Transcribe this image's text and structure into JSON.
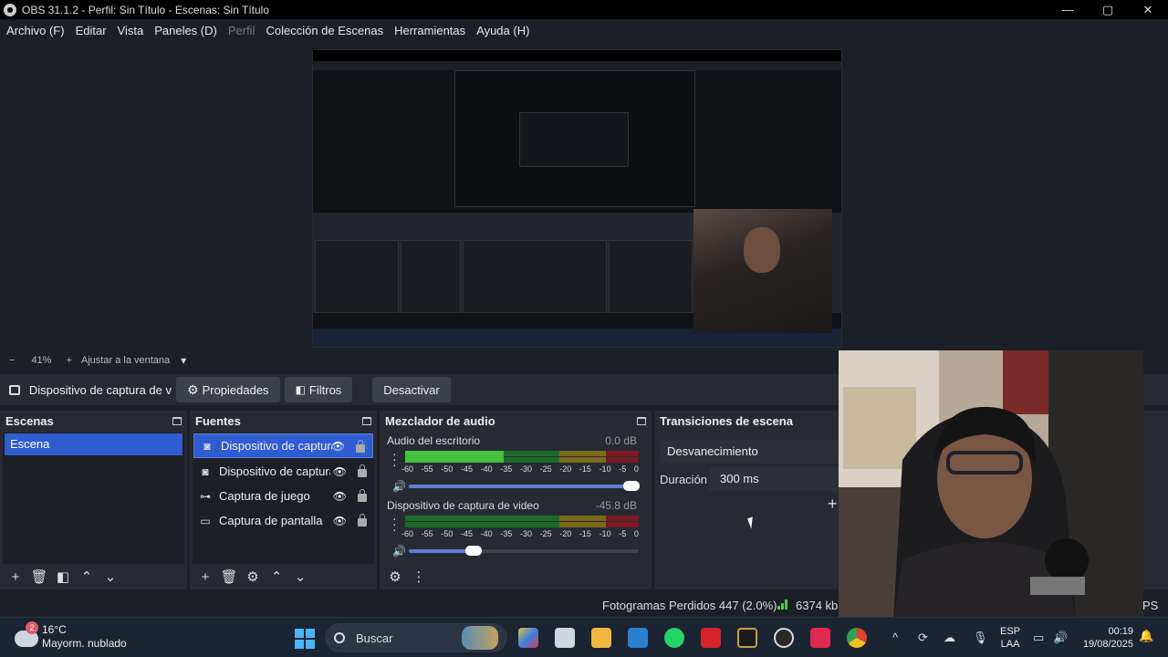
{
  "window": {
    "title": "OBS 31.1.2 - Perfil: Sin Título - Escenas: Sin Título",
    "minimize": "—",
    "maximize": "▢",
    "close": "✕"
  },
  "menu": [
    {
      "label": "Archivo (F)",
      "disabled": false
    },
    {
      "label": "Editar",
      "disabled": false
    },
    {
      "label": "Vista",
      "disabled": false
    },
    {
      "label": "Paneles (D)",
      "disabled": false
    },
    {
      "label": "Perfil",
      "disabled": true
    },
    {
      "label": "Colección de Escenas",
      "disabled": false
    },
    {
      "label": "Herramientas",
      "disabled": false
    },
    {
      "label": "Ayuda (H)",
      "disabled": false
    }
  ],
  "zoom": {
    "minus": "−",
    "value": "41%",
    "plus": "+",
    "fit": "Ajustar a la ventana",
    "caret": "▾"
  },
  "source_toolbar": {
    "source_name": "Dispositivo de captura de v",
    "properties": "Propiedades",
    "filters": "Filtros",
    "deactivate": "Desactivar"
  },
  "scenes": {
    "title": "Escenas",
    "items": [
      "Escena"
    ]
  },
  "sources": {
    "title": "Fuentes",
    "items": [
      {
        "label": "Dispositivo de captura",
        "icon": "camera-icon",
        "glyph": "◙",
        "selected": true
      },
      {
        "label": "Dispositivo de captura",
        "icon": "camera-icon",
        "glyph": "◙",
        "selected": false
      },
      {
        "label": "Captura de juego",
        "icon": "gamepad-icon",
        "glyph": "⊶",
        "selected": false
      },
      {
        "label": "Captura de pantalla",
        "icon": "monitor-icon",
        "glyph": "▭",
        "selected": false
      }
    ]
  },
  "mixer": {
    "title": "Mezclador de audio",
    "ticks": [
      "-60",
      "-55",
      "-50",
      "-45",
      "-40",
      "-35",
      "-30",
      "-25",
      "-20",
      "-15",
      "-10",
      "-5",
      "0"
    ],
    "channels": [
      {
        "name": "Audio del escritorio",
        "db": "0.0 dB",
        "level": 0.42,
        "volume": 0.97
      },
      {
        "name": "Dispositivo de captura de video",
        "db": "-45.8 dB",
        "level": 0.0,
        "volume": 0.28
      }
    ]
  },
  "transitions": {
    "title": "Transiciones de escena",
    "selected": "Desvanecimiento",
    "duration_label": "Duración",
    "duration_value": "300 ms",
    "add": "+"
  },
  "status": {
    "dropped": "Fotogramas Perdidos 447 (2.0%)",
    "bitrate": "6374 kbp",
    "fps": "PS"
  },
  "taskbar": {
    "temp": "16°C",
    "weather": "Mayorm. nublado",
    "weather_badge": "2",
    "search": "Buscar",
    "lang_top": "ESP",
    "lang_bottom": "LAA",
    "time": "00:19",
    "date": "19/08/2025"
  },
  "colors": {
    "accent": "#2f5ccf",
    "dock_bg": "#272a33",
    "app_bg": "#1d1f26",
    "meter_green": "#44c23e"
  }
}
